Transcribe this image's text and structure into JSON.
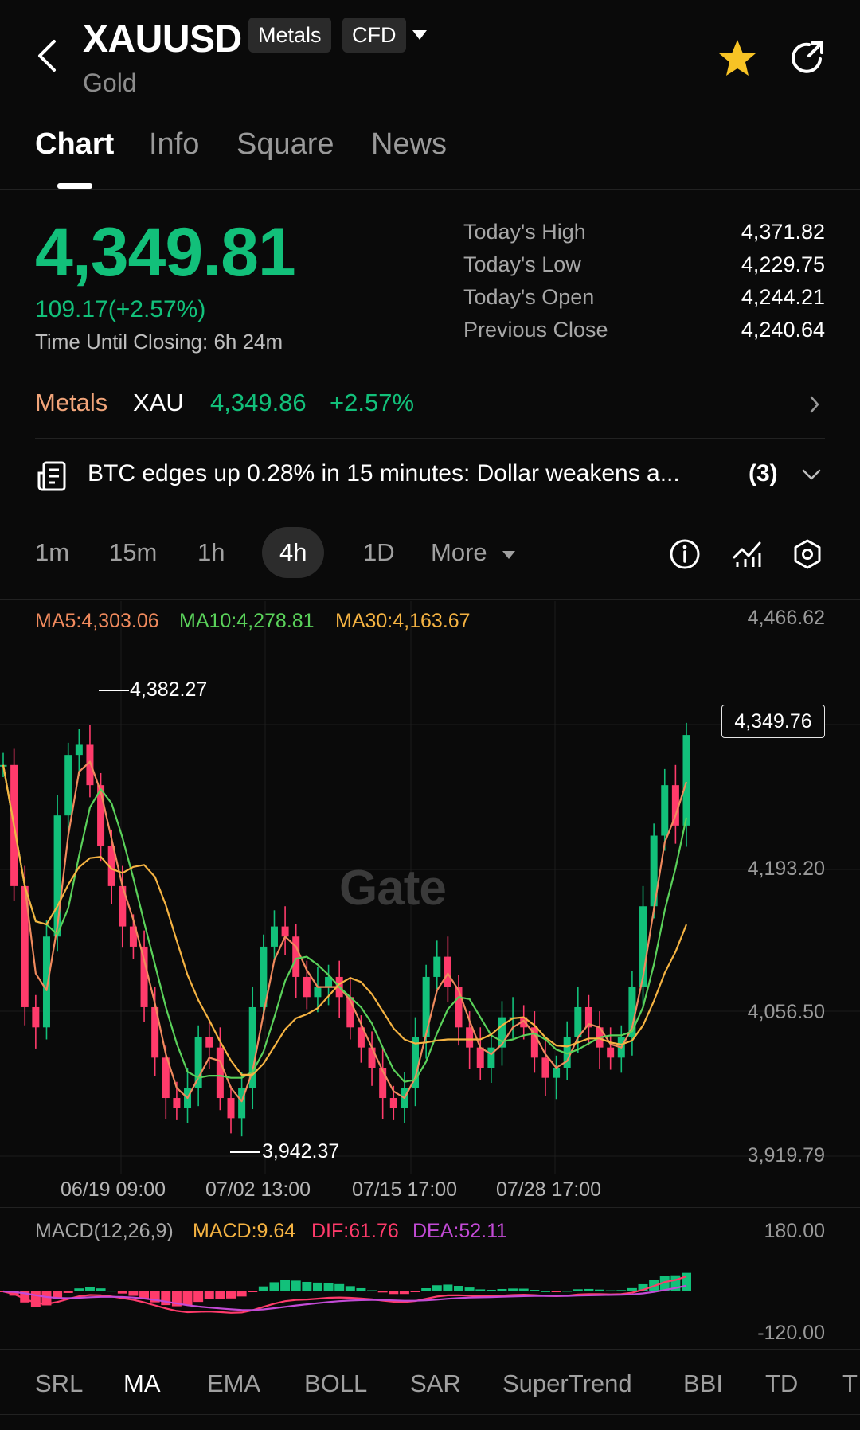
{
  "header": {
    "symbol": "XAUUSD",
    "chips": [
      "Metals",
      "CFD"
    ],
    "subtitle": "Gold"
  },
  "tabs": [
    "Chart",
    "Info",
    "Square",
    "News"
  ],
  "quote": {
    "price": "4,349.81",
    "change": "109.17(+2.57%)",
    "closing_label": "Time Until Closing:",
    "closing_value": "6h 24m",
    "stats": [
      {
        "label": "Today's High",
        "value": "4,371.82"
      },
      {
        "label": "Today's Low",
        "value": "4,229.75"
      },
      {
        "label": "Today's Open",
        "value": "4,244.21"
      },
      {
        "label": "Previous Close",
        "value": "4,240.64"
      }
    ]
  },
  "metals_row": {
    "category": "Metals",
    "symbol": "XAU",
    "price": "4,349.86",
    "change": "+2.57%"
  },
  "news": {
    "text": "BTC edges up 0.28% in 15 minutes: Dollar weakens a...",
    "count": "(3)"
  },
  "intervals": [
    "1m",
    "15m",
    "1h",
    "4h",
    "1D",
    "More"
  ],
  "active_interval": "4h",
  "ma_legend": {
    "ma5": "MA5:4,303.06",
    "ma10": "MA10:4,278.81",
    "ma30": "MA30:4,163.67"
  },
  "colors": {
    "up": "#12c07a",
    "down": "#ff3b6b",
    "ma5": "#f08a5d",
    "ma10": "#5ad15a",
    "ma30": "#f5b342",
    "metals_label": "#f2a57a"
  },
  "chart_data": {
    "type": "candlestick",
    "y_ticks": [
      "4,466.62",
      "4,193.20",
      "4,056.50",
      "3,919.79"
    ],
    "x_ticks": [
      "06/19 09:00",
      "07/02 13:00",
      "07/15 17:00",
      "07/28 17:00"
    ],
    "high_annotation": "4,382.27",
    "low_annotation": "3,942.37",
    "current_price_tag": "4,349.76",
    "watermark": "Gate",
    "close_series": [
      4320,
      4200,
      4080,
      4060,
      4150,
      4270,
      4330,
      4340,
      4300,
      4240,
      4200,
      4160,
      4140,
      4080,
      4030,
      3990,
      3980,
      4000,
      4050,
      4040,
      3990,
      3970,
      4000,
      4080,
      4140,
      4160,
      4150,
      4110,
      4090,
      4100,
      4110,
      4090,
      4060,
      4040,
      4020,
      3990,
      3980,
      4000,
      4050,
      4110,
      4130,
      4100,
      4060,
      4040,
      4020,
      4040,
      4070,
      4070,
      4060,
      4030,
      4010,
      4020,
      4050,
      4080,
      4060,
      4040,
      4030,
      4050,
      4100,
      4180,
      4250,
      4300,
      4260,
      4349.76
    ]
  },
  "macd": {
    "label": "MACD(12,26,9)",
    "macd": "MACD:9.64",
    "dif": "DIF:61.76",
    "dea": "DEA:52.11",
    "y_ticks": [
      "180.00",
      "-120.00"
    ]
  },
  "indicators": [
    "SRL",
    "MA",
    "EMA",
    "BOLL",
    "SAR",
    "SuperTrend",
    "BBI",
    "TD",
    "T"
  ],
  "active_indicator": "MA"
}
